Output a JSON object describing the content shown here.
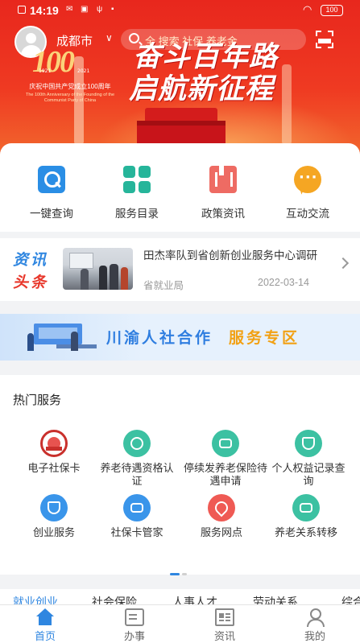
{
  "status_bar": {
    "time": "14:19",
    "battery": "100"
  },
  "header": {
    "city": "成都市",
    "search_placeholder": "全  搜索  社保  养老金",
    "banner_line1": "奋斗百年路",
    "banner_line2": "启航新征程",
    "anniversary_number": "100",
    "anniversary_year_left": "1921",
    "anniversary_year_right": "2021",
    "anniversary_text": "庆祝中国共产党成立100周年",
    "anniversary_en": "The 100th Anniversary of the Founding of the Communist Party of China"
  },
  "quick_services": [
    {
      "label": "一键查询",
      "icon": "search-icon"
    },
    {
      "label": "服务目录",
      "icon": "grid-icon"
    },
    {
      "label": "政策资讯",
      "icon": "book-icon"
    },
    {
      "label": "互动交流",
      "icon": "chat-icon"
    }
  ],
  "news": {
    "tag_line1": "资讯",
    "tag_line2": "头条",
    "title": "田杰率队到省创新创业服务中心调研",
    "source": "省就业局",
    "date": "2022-03-14"
  },
  "coop_banner": {
    "text_main": "川渝人社合作",
    "text_highlight": "服务专区"
  },
  "hot_services": {
    "heading": "热门服务",
    "items": [
      {
        "label": "电子社保卡",
        "icon": "social-card-seal-icon"
      },
      {
        "label": "养老待遇资格认证",
        "icon": "elderly-certify-icon"
      },
      {
        "label": "停续发养老保险待遇申请",
        "icon": "pension-apply-icon"
      },
      {
        "label": "个人权益记录查询",
        "icon": "rights-record-icon"
      },
      {
        "label": "创业服务",
        "icon": "startup-shield-icon"
      },
      {
        "label": "社保卡管家",
        "icon": "card-manager-icon"
      },
      {
        "label": "服务网点",
        "icon": "location-pin-icon"
      },
      {
        "label": "养老关系转移",
        "icon": "transfer-icon"
      }
    ]
  },
  "categories": [
    {
      "label": "就业创业",
      "active": true
    },
    {
      "label": "社会保险",
      "active": false
    },
    {
      "label": "人事人才",
      "active": false
    },
    {
      "label": "劳动关系",
      "active": false
    },
    {
      "label": "综合",
      "active": false
    }
  ],
  "bottom_nav": [
    {
      "label": "首页",
      "icon": "home-icon",
      "active": true
    },
    {
      "label": "办事",
      "icon": "task-icon",
      "active": false
    },
    {
      "label": "资讯",
      "icon": "news-icon",
      "active": false
    },
    {
      "label": "我的",
      "icon": "user-icon",
      "active": false
    }
  ],
  "colors": {
    "primary": "#2f86e0",
    "banner_red": "#e8271d",
    "accent_orange": "#f2a114"
  }
}
